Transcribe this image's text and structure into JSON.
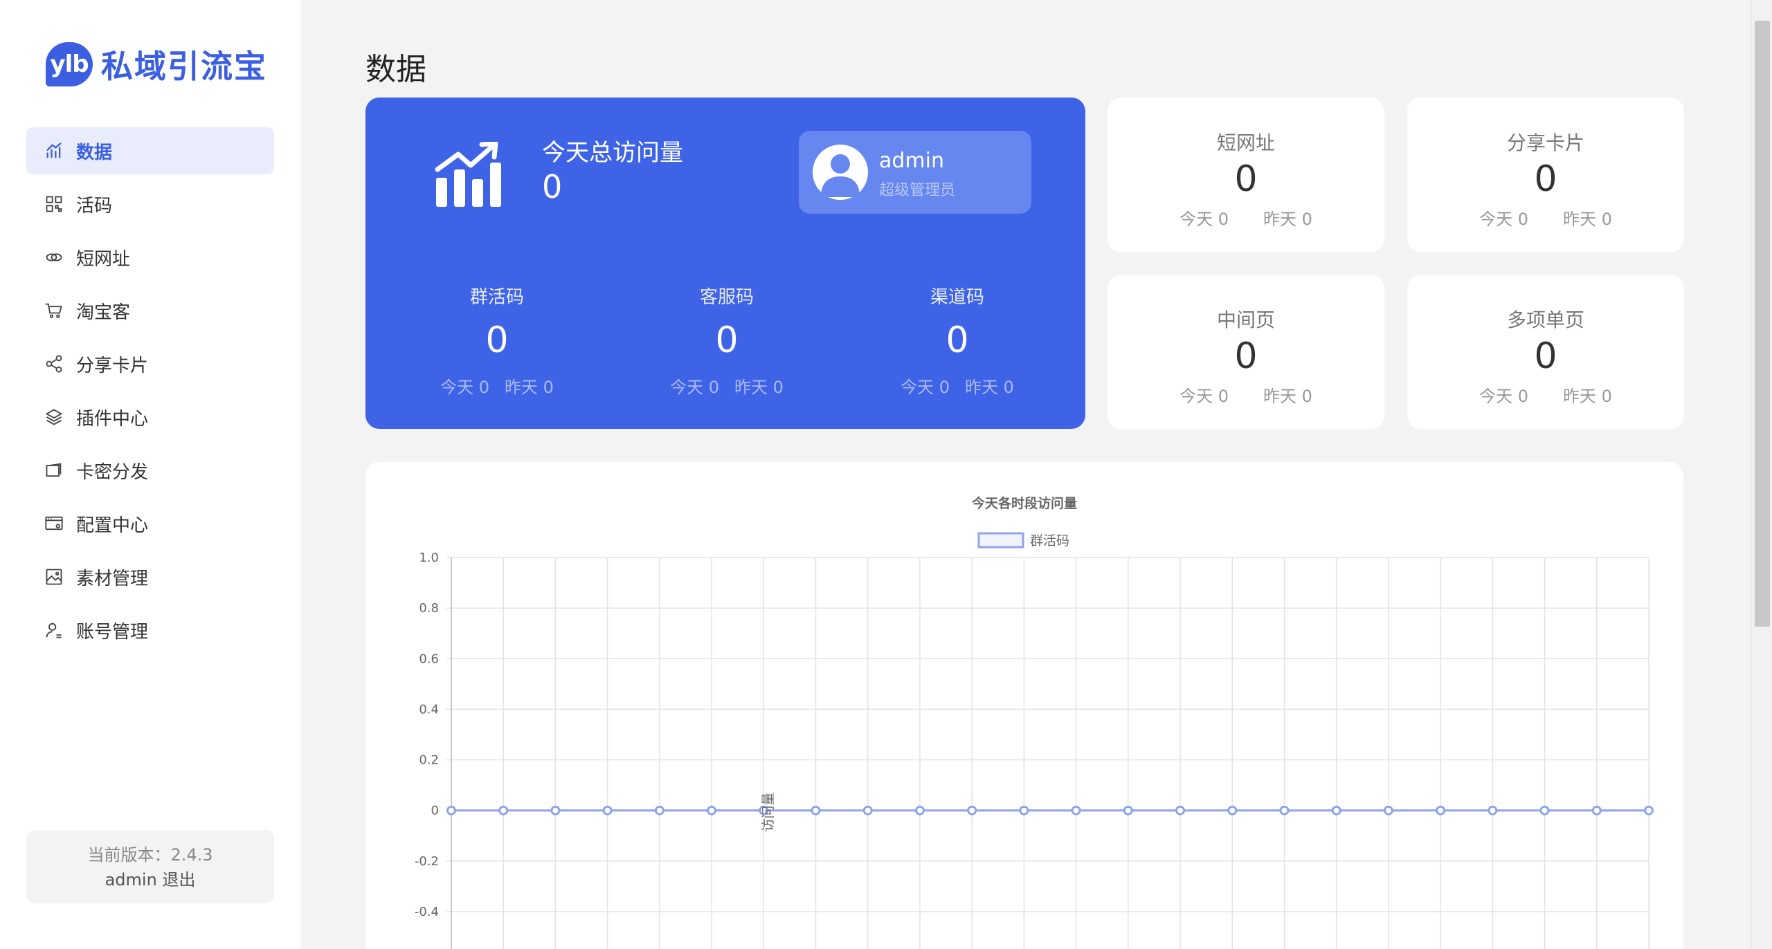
{
  "app": {
    "logo_badge": "ylb",
    "logo_text": "私域引流宝",
    "brand_color": "#3b5fe0"
  },
  "sidebar": {
    "items": [
      {
        "label": "数据",
        "icon": "bar-chart-icon",
        "active": true
      },
      {
        "label": "活码",
        "icon": "qr-grid-icon"
      },
      {
        "label": "短网址",
        "icon": "link-icon"
      },
      {
        "label": "淘宝客",
        "icon": "cart-icon"
      },
      {
        "label": "分享卡片",
        "icon": "share-icon"
      },
      {
        "label": "插件中心",
        "icon": "layers-icon"
      },
      {
        "label": "卡密分发",
        "icon": "card-icon"
      },
      {
        "label": "配置中心",
        "icon": "config-icon"
      },
      {
        "label": "素材管理",
        "icon": "image-icon"
      },
      {
        "label": "账号管理",
        "icon": "user-settings-icon"
      }
    ],
    "version": "当前版本：2.4.3",
    "username": "admin",
    "logout": "退出"
  },
  "page": {
    "title": "数据"
  },
  "summary": {
    "today_label": "今天总访问量",
    "today_value": "0",
    "user": {
      "name": "admin",
      "role": "超级管理员"
    },
    "codes": [
      {
        "label": "群活码",
        "value": "0",
        "today": "今天 0",
        "yesterday": "昨天 0"
      },
      {
        "label": "客服码",
        "value": "0",
        "today": "今天 0",
        "yesterday": "昨天 0"
      },
      {
        "label": "渠道码",
        "value": "0",
        "today": "今天 0",
        "yesterday": "昨天 0"
      }
    ]
  },
  "stats": [
    {
      "label": "短网址",
      "value": "0",
      "today": "今天 0",
      "yesterday": "昨天 0"
    },
    {
      "label": "分享卡片",
      "value": "0",
      "today": "今天 0",
      "yesterday": "昨天 0"
    },
    {
      "label": "中间页",
      "value": "0",
      "today": "今天 0",
      "yesterday": "昨天 0"
    },
    {
      "label": "多项单页",
      "value": "0",
      "today": "今天 0",
      "yesterday": "昨天 0"
    }
  ],
  "chart_data": {
    "type": "line",
    "title": "今天各时段访问量",
    "ylabel": "访问量",
    "xlabel": "",
    "series": [
      {
        "name": "群活码",
        "values": [
          0,
          0,
          0,
          0,
          0,
          0,
          0,
          0,
          0,
          0,
          0,
          0,
          0,
          0,
          0,
          0,
          0,
          0,
          0,
          0,
          0,
          0,
          0,
          0
        ],
        "color": "#8fa4e8"
      }
    ],
    "point_count": 24,
    "y_ticks": [
      "1.0",
      "0.8",
      "0.6",
      "0.4",
      "0.2",
      "0",
      "-0.2",
      "-0.4"
    ],
    "ylim": [
      -0.4,
      1.0
    ],
    "grid": true,
    "legend": "top-center"
  }
}
